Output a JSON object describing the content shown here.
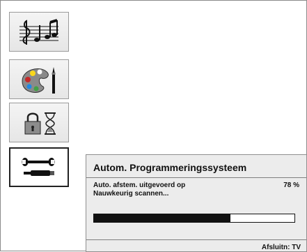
{
  "sidebar": {
    "items": [
      {
        "name": "music-notes-icon",
        "selected": false
      },
      {
        "name": "paint-palette-icon",
        "selected": false
      },
      {
        "name": "lock-timer-icon",
        "selected": false
      },
      {
        "name": "wrench-screwdriver-icon",
        "selected": true
      }
    ]
  },
  "dialog": {
    "title": "Autom. Programmeringssysteem",
    "status_line1": "Auto. afstem. uitgevoerd op",
    "status_line2": "Nauwkeurig scannen...",
    "percent_label": "78 %",
    "progress_fraction": 0.68,
    "footer_hint": "Afsluitn: TV"
  }
}
